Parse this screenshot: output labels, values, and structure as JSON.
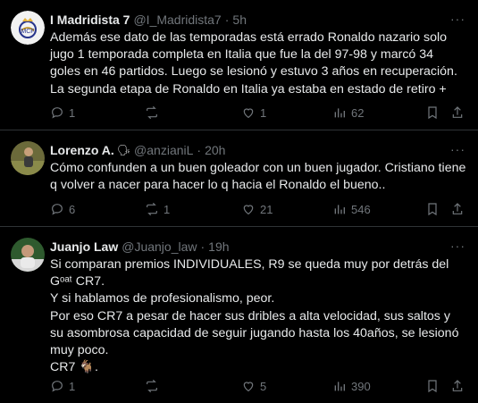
{
  "tweets": [
    {
      "name": "I Madridista 7",
      "name_emoji": "",
      "handle": "@I_Madridista7",
      "time": "5h",
      "text": "Además ese dato de las temporadas está errado Ronaldo nazario solo jugo 1 temporada completa en Italia que fue la del 97-98 y marcó 34 goles en 46 partidos. Luego se lesionó y estuvo 3 años en recuperación. La segunda etapa de Ronaldo en Italia ya estaba en estado de retiro +",
      "replies": "1",
      "retweets": "",
      "likes": "1",
      "views": "62"
    },
    {
      "name": "Lorenzo A.",
      "name_emoji": "🗣",
      "handle": "@anzianiL",
      "time": "20h",
      "text": "Cómo confunden a un buen goleador con un buen jugador. Cristiano tiene q volver a nacer para hacer lo q hacia el Ronaldo el bueno..",
      "replies": "6",
      "retweets": "1",
      "likes": "21",
      "views": "546"
    },
    {
      "name": "Juanjo Law",
      "name_emoji": "",
      "handle": "@Juanjo_law",
      "time": "19h",
      "text_lines": [
        "Si comparan premios INDIVIDUALES, R9 se queda muy por detrás del Gᵒᵃᵗ CR7.",
        "Y si hablamos de profesionalismo, peor.",
        "Por eso CR7 a pesar de hacer sus dribles a alta velocidad, sus saltos y su asombrosa capacidad de seguir jugando hasta los 40años, se lesionó muy poco.",
        "CR7 🐐."
      ],
      "replies": "1",
      "retweets": "",
      "likes": "5",
      "views": "390"
    }
  ],
  "separator": "·",
  "more_glyph": "···",
  "colors": {
    "background": "#000000",
    "text": "#e7e9ea",
    "muted": "#71767b",
    "divider": "#2f3336"
  }
}
